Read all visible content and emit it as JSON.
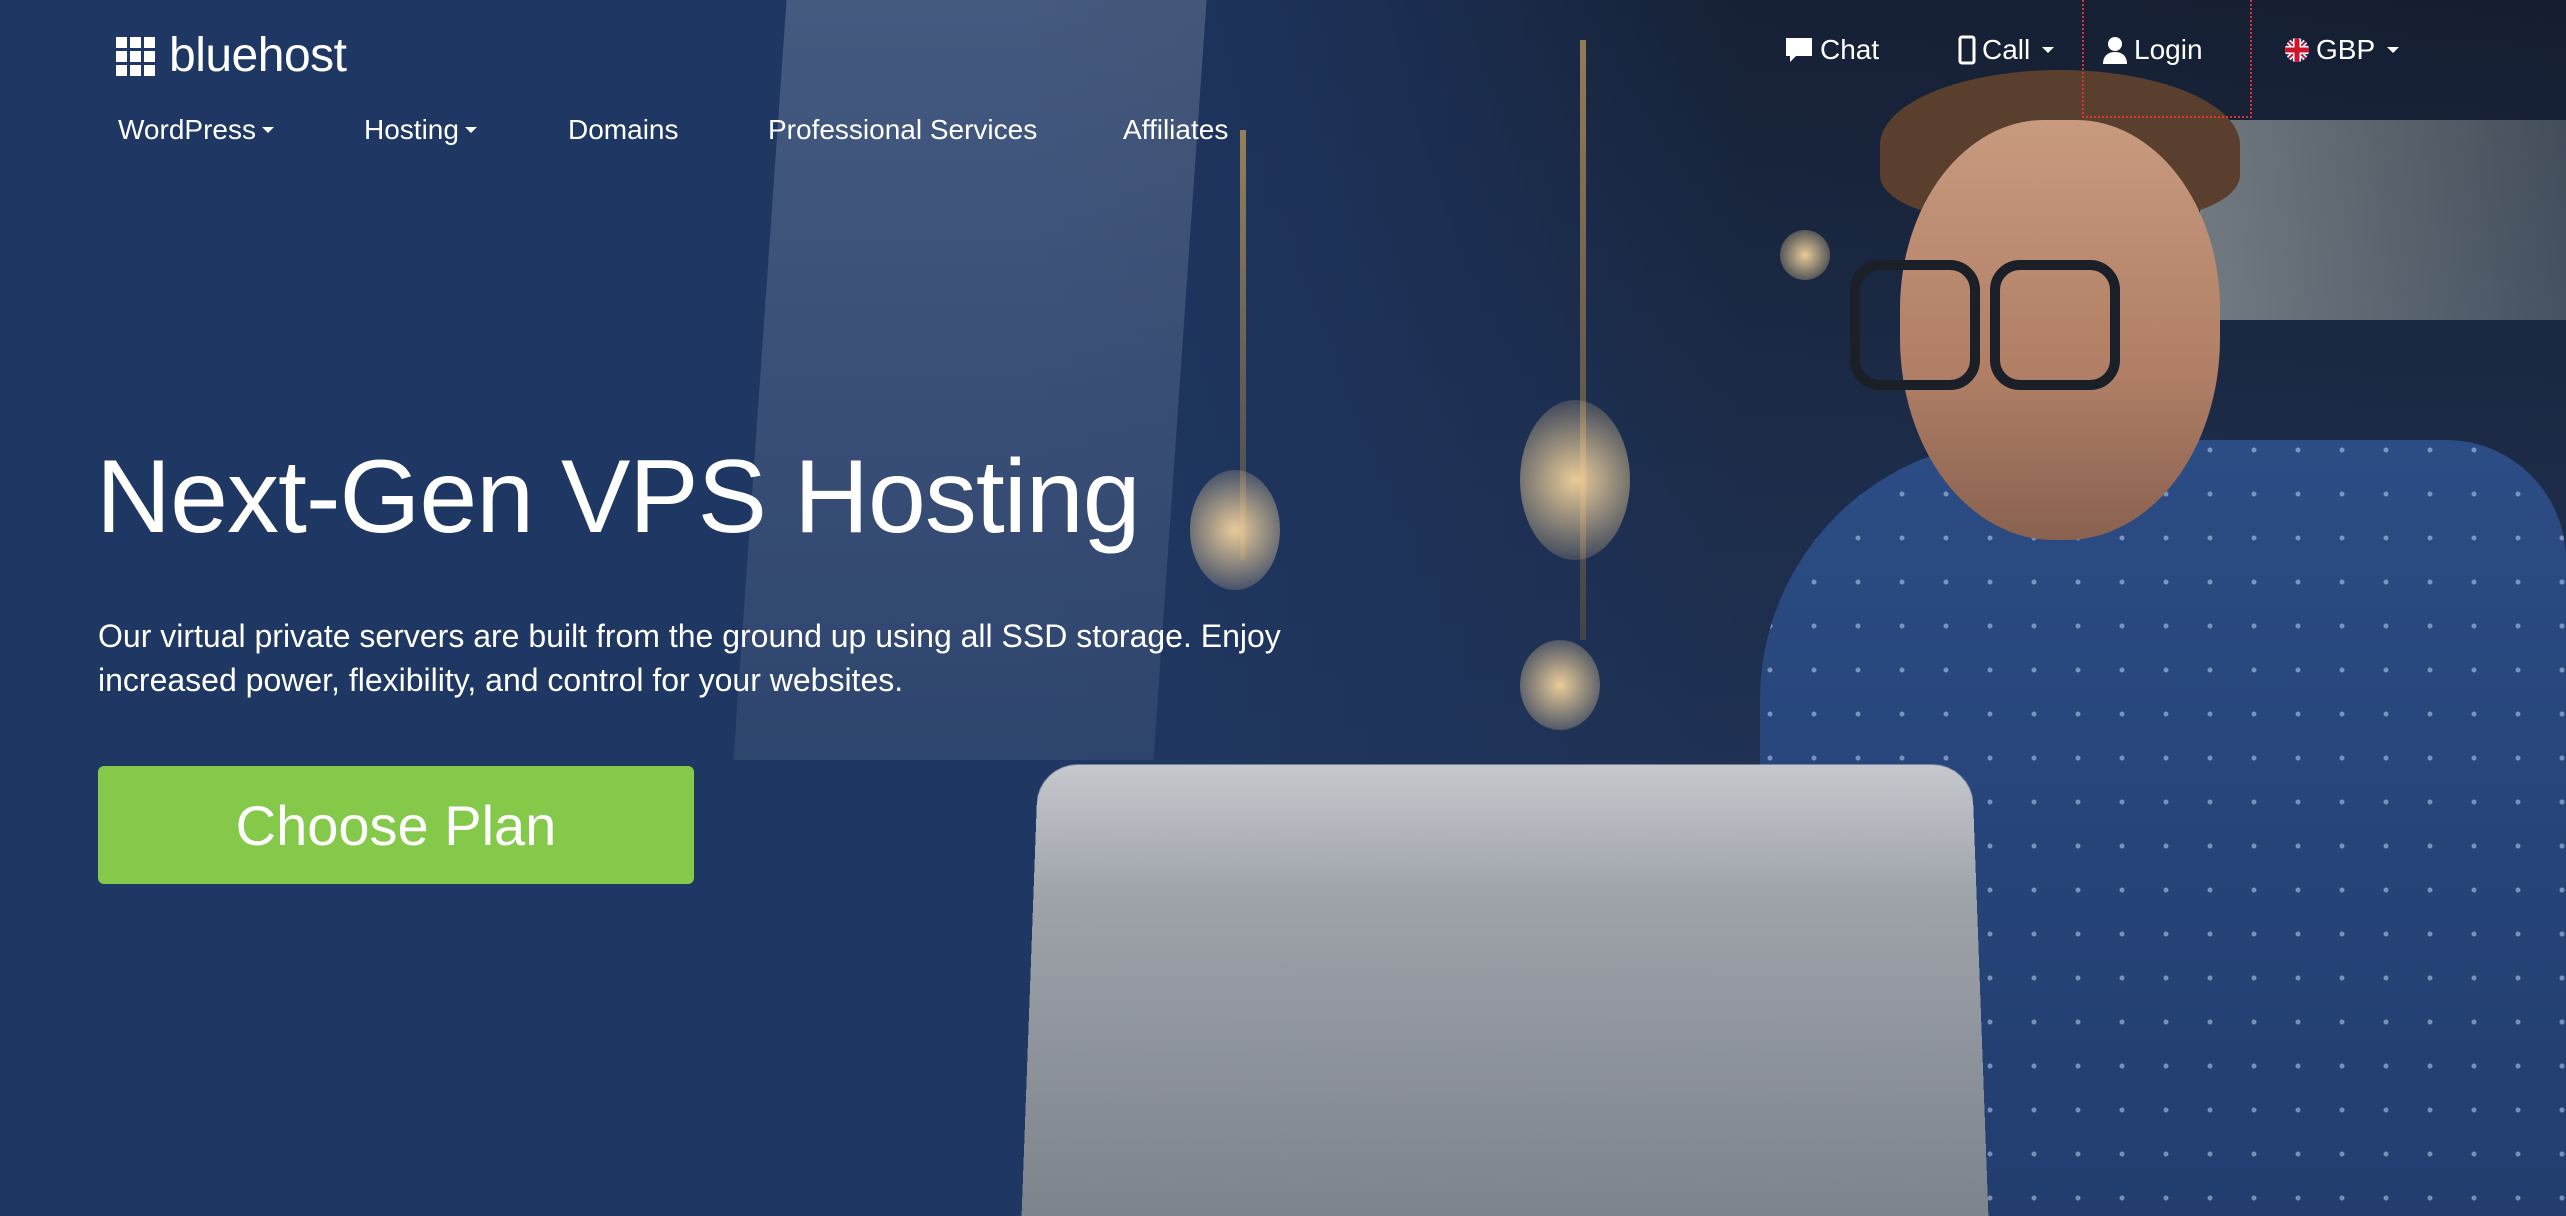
{
  "brand": {
    "name": "bluehost",
    "accent_color": "#85c94a",
    "background_color": "#1f3763"
  },
  "topbar": {
    "items": [
      {
        "label": "Chat",
        "icon": "chat-bubble-icon"
      },
      {
        "label": "Call",
        "icon": "phone-icon",
        "dropdown": true
      },
      {
        "label": "Login",
        "icon": "user-icon"
      },
      {
        "label": "GBP",
        "icon": "uk-flag-icon",
        "dropdown": true
      }
    ]
  },
  "nav": {
    "items": [
      {
        "label": "WordPress",
        "dropdown": true
      },
      {
        "label": "Hosting",
        "dropdown": true
      },
      {
        "label": "Domains"
      },
      {
        "label": "Professional Services"
      },
      {
        "label": "Affiliates"
      }
    ]
  },
  "hero": {
    "title": "Next-Gen VPS Hosting",
    "description": "Our virtual private servers are built from the ground up using all SSD storage. Enjoy increased power, flexibility, and control for your websites.",
    "cta_label": "Choose Plan"
  }
}
